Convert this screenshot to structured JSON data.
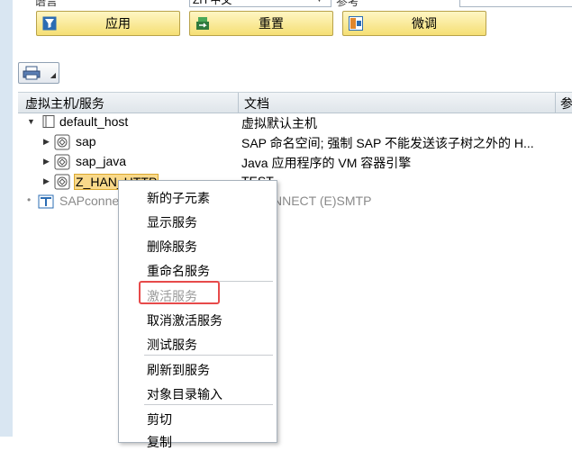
{
  "top_row": {
    "label1": "语言",
    "field1_value": "ZH 中文",
    "label2": "参考"
  },
  "toolbar": {
    "apply_label": "应用",
    "reset_label": "重置",
    "tune_label": "微调"
  },
  "grid": {
    "headers": [
      "虚拟主机/服务",
      "文档",
      "参"
    ],
    "rows": [
      {
        "name": "default_host",
        "doc": "虚拟默认主机"
      },
      {
        "name": "sap",
        "doc": "SAP 命名空间; 强制 SAP 不能发送该子树之外的 H..."
      },
      {
        "name": "sap_java",
        "doc": "Java 应用程序的 VM 容器引擎"
      },
      {
        "name": "Z_HAN_HTTP",
        "doc": "TEST"
      },
      {
        "name": "SAPconnect",
        "doc": "CONNECT (E)SMTP"
      }
    ]
  },
  "context_menu": {
    "items": [
      "新的子元素",
      "显示服务",
      "删除服务",
      "重命名服务",
      "激活服务",
      "取消激活服务",
      "测试服务",
      "刷新到服务",
      "对象目录输入",
      "剪切",
      "复制"
    ]
  },
  "colors": {
    "button_bg": "#f5df74",
    "highlight_border": "#e74a4a",
    "selected_node_bg": "#f9d98a"
  },
  "icons": [
    "filter-icon",
    "reset-icon",
    "tune-icon",
    "print-icon",
    "folder-book-icon",
    "service-node-icon",
    "mail-node-icon"
  ]
}
